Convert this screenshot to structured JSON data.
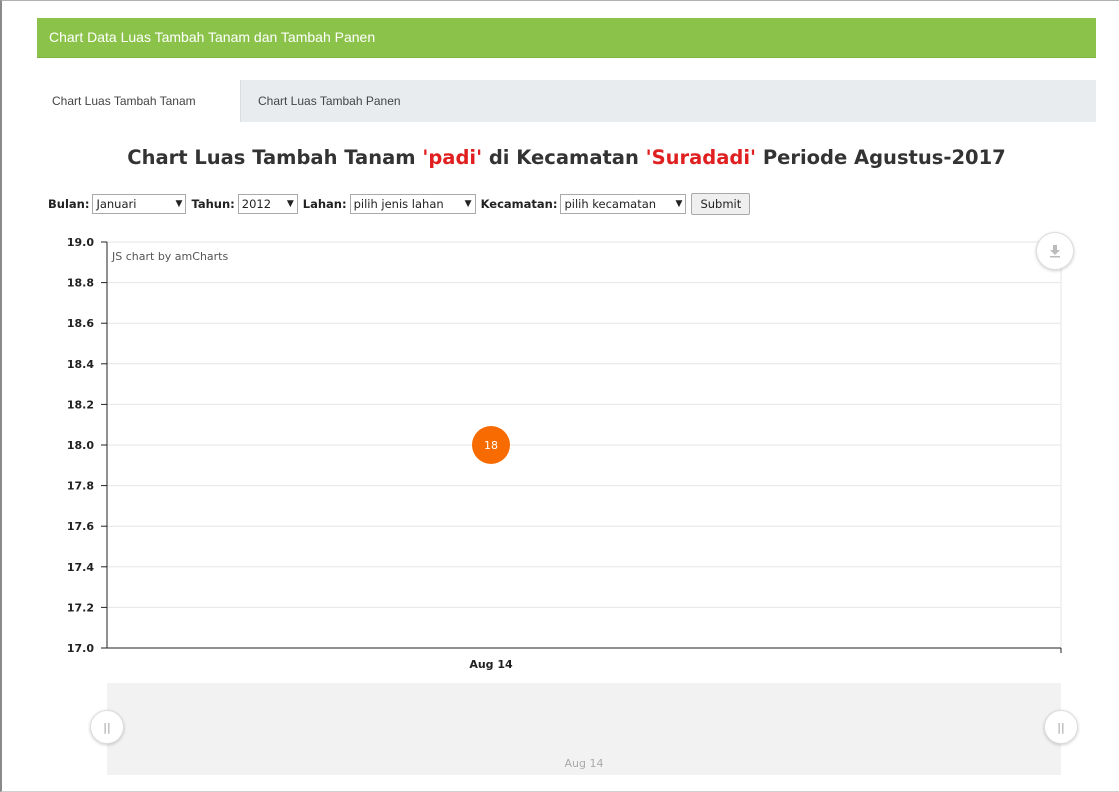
{
  "panel": {
    "title": "Chart Data Luas Tambah Tanam dan Tambah Panen"
  },
  "tabs": [
    {
      "label": "Chart Luas Tambah Tanam",
      "active": true
    },
    {
      "label": "Chart Luas Tambah Panen",
      "active": false
    }
  ],
  "heading": {
    "prefix": "Chart Luas Tambah Tanam ",
    "commodity": "'padi'",
    "middle": " di Kecamatan ",
    "district": "'Suradadi'",
    "suffix": " Periode Agustus-2017"
  },
  "filters": {
    "bulan_label": "Bulan:",
    "bulan_value": "Januari",
    "tahun_label": "Tahun:",
    "tahun_value": "2012",
    "lahan_label": "Lahan:",
    "lahan_value": "pilih jenis lahan",
    "kecamatan_label": "Kecamatan:",
    "kecamatan_value": "pilih kecamatan",
    "submit_label": "Submit"
  },
  "chart_data": {
    "type": "line",
    "credit": "JS chart by amCharts",
    "x": [
      "Aug 14"
    ],
    "series": [
      {
        "values": [
          18
        ]
      }
    ],
    "ylim": [
      17.0,
      19.0
    ],
    "yticks": [
      "19.0",
      "18.8",
      "18.6",
      "18.4",
      "18.2",
      "18.0",
      "17.8",
      "17.6",
      "17.4",
      "17.2",
      "17.0"
    ],
    "point_labels": [
      "18"
    ],
    "scrollbar_label": "Aug 14",
    "grid": true,
    "colors": {
      "point": "#f76b00",
      "grid": "#e6e6e6",
      "axis": "#222222"
    }
  },
  "icons": {
    "export": "download-icon",
    "handle": "grip-icon"
  }
}
